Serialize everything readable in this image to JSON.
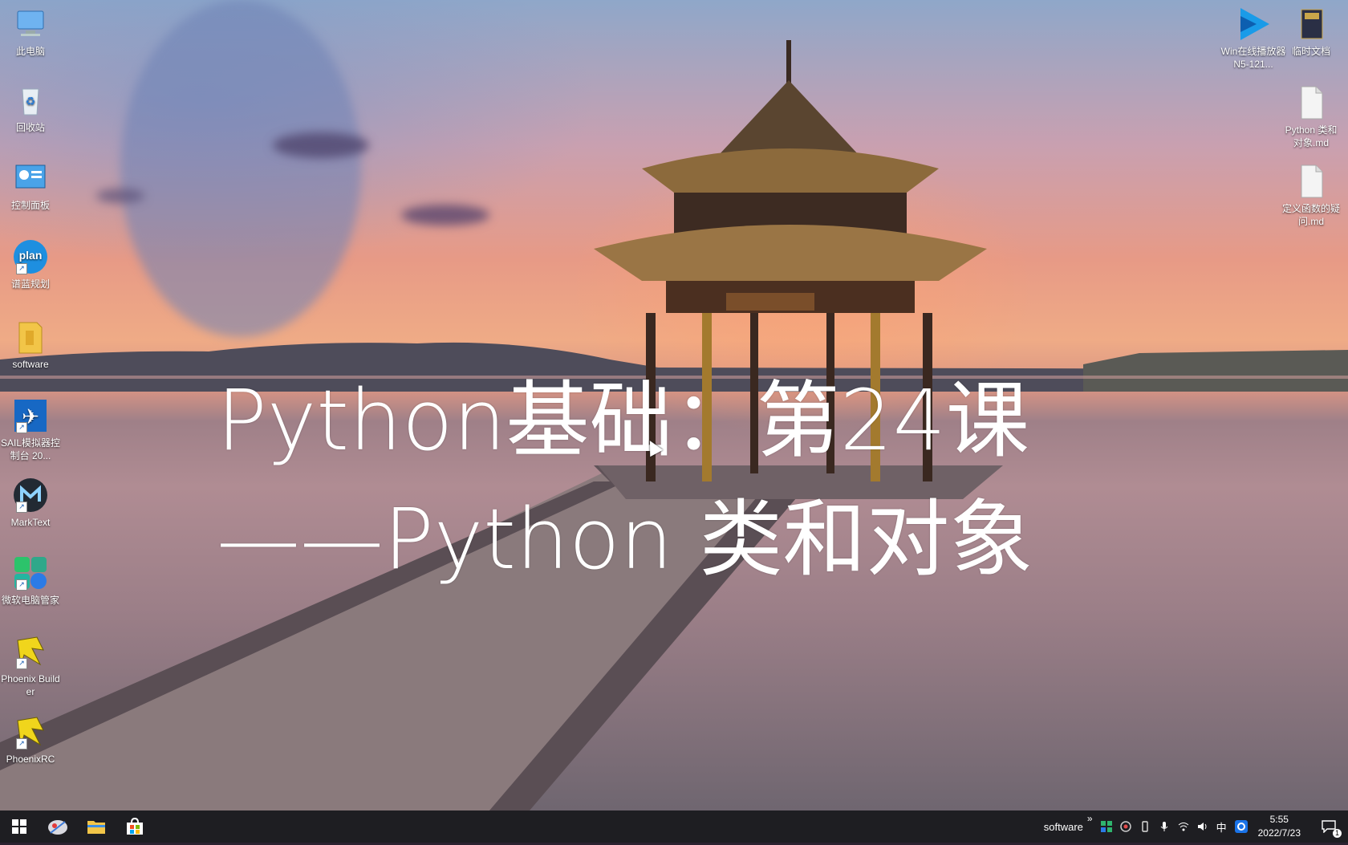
{
  "desktop_icons_left": [
    {
      "label": "此电脑",
      "icon": "computer-icon"
    },
    {
      "label": "回收站",
      "icon": "recycle-bin-icon"
    },
    {
      "label": "控制面板",
      "icon": "control-panel-icon"
    },
    {
      "label": "谱蓝规划",
      "icon": "plan-app-icon",
      "badge": "plan"
    },
    {
      "label": "software",
      "icon": "folder-icon"
    },
    {
      "label": "SAIL模拟器控制台 20...",
      "icon": "airplane-icon"
    },
    {
      "label": "MarkText",
      "icon": "marktext-icon"
    },
    {
      "label": "微软电脑管家",
      "icon": "pc-manager-icon"
    },
    {
      "label": "Phoenix Builder",
      "icon": "phoenix-builder-icon"
    },
    {
      "label": "PhoenixRC",
      "icon": "phoenixrc-icon"
    }
  ],
  "desktop_icons_right": [
    {
      "label": "Win在线播放器N5-121...",
      "icon": "player-icon"
    },
    {
      "label": "临时文档",
      "icon": "book-icon"
    },
    {
      "label": "Python 类和对象.md",
      "icon": "markdown-file-icon"
    },
    {
      "label": "定义函数的疑问.md",
      "icon": "markdown-file-icon"
    }
  ],
  "overlay_title": {
    "line1": "Python基础：第24课",
    "line2": "——Python 类和对象"
  },
  "taskbar": {
    "tray_label": "software",
    "tray_chevron": "»",
    "input_method": "中",
    "time": "5:55",
    "date": "2022/7/23",
    "notification_count": "1"
  },
  "colors": {
    "taskbar_bg": "#1e1e22",
    "accent_blue": "#1a73e8"
  }
}
